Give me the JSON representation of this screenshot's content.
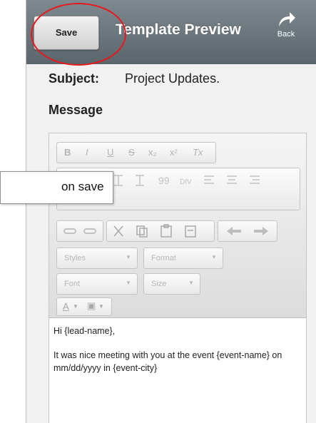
{
  "header": {
    "save_label": "Save",
    "title": "Template Preview",
    "back_label": "Back"
  },
  "subject": {
    "label": "Subject:",
    "value": "Project Updates."
  },
  "message": {
    "label": "Message"
  },
  "toolbar": {
    "row1": [
      "B",
      "I",
      "U",
      "S",
      "x₂",
      "x²",
      "Tx"
    ],
    "styles_label": "Styles",
    "format_label": "Format",
    "font_label": "Font",
    "size_label": "Size",
    "text_color_label": "A",
    "bg_color_label": "▣"
  },
  "body": {
    "line1": "Hi {lead-name},",
    "line2": "It was nice meeting with you at the event {event-name} on mm/dd/yyyy in {event-city}"
  },
  "callout": {
    "text": "on save"
  },
  "colors": {
    "header": "#6b777c",
    "highlight_ring": "#e8181f"
  }
}
